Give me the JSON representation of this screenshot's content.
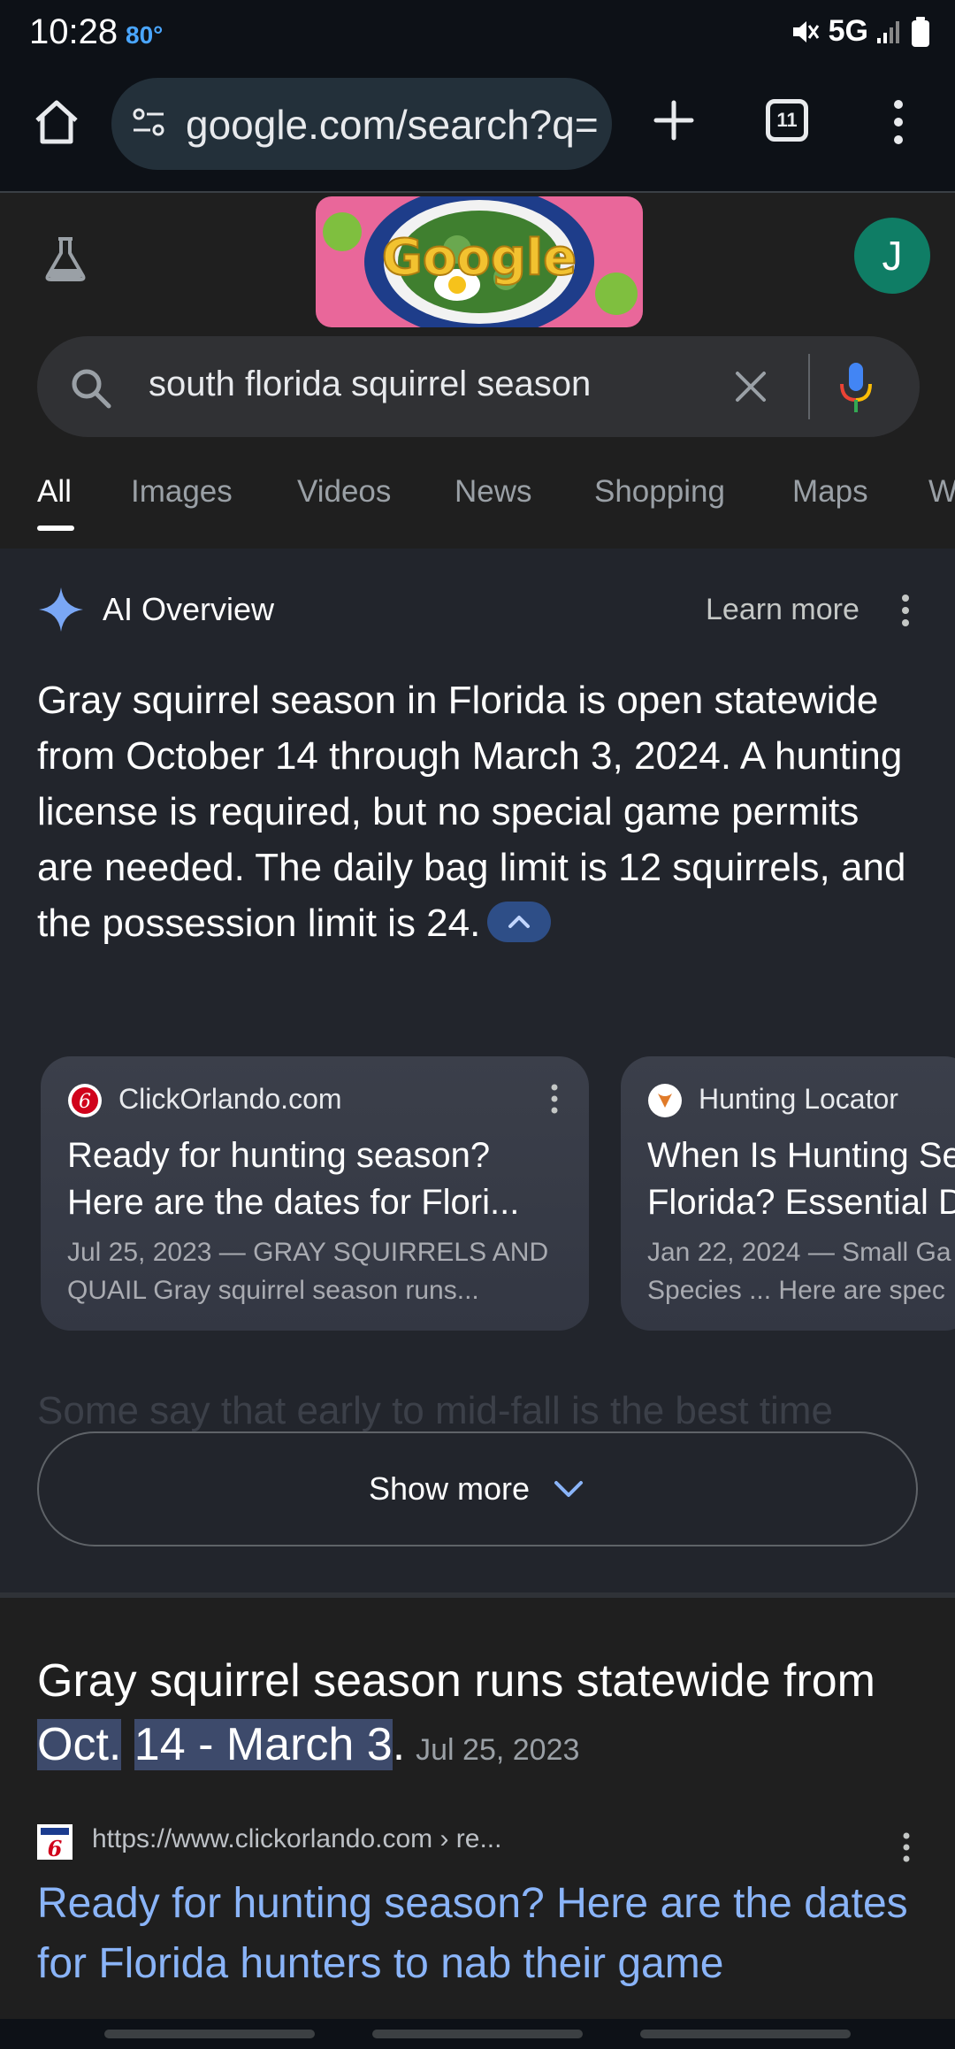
{
  "status_bar": {
    "time": "10:28",
    "temperature": "80°",
    "network": "5G"
  },
  "browser": {
    "url": "google.com/search?q=",
    "tab_count": "11"
  },
  "header": {
    "avatar_letter": "J",
    "doodle_text": "Google"
  },
  "search": {
    "query": "south florida squirrel season"
  },
  "tabs": [
    {
      "label": "All"
    },
    {
      "label": "Images"
    },
    {
      "label": "Videos"
    },
    {
      "label": "News"
    },
    {
      "label": "Shopping"
    },
    {
      "label": "Maps"
    },
    {
      "label": "W"
    }
  ],
  "ai_overview": {
    "title": "AI Overview",
    "learn_more": "Learn more",
    "body": "Gray squirrel season in Florida is open statewide from October 14 through March 3, 2024. A hunting license is required, but no special game permits are needed. The daily bag limit is 12 squirrels, and the possession limit is 24.",
    "faded_text": "Some say that early to mid-fall is the best time",
    "show_more": "Show more",
    "sources": [
      {
        "site": "ClickOrlando.com",
        "title": "Ready for hunting season? Here are the dates for Flori...",
        "snippet": "Jul 25, 2023 — GRAY SQUIRRELS AND QUAIL Gray squirrel season runs..."
      },
      {
        "site": "Hunting Locator",
        "title": "When Is Hunting Se Florida? Essential D",
        "snippet": "Jan 22, 2024 — Small Ga Species ... Here are spec"
      }
    ]
  },
  "featured": {
    "text_before": "Gray squirrel season runs statewide from ",
    "highlight_1": "Oct.",
    "highlight_2": "14 - March 3",
    "text_after": ".",
    "date": "Jul 25, 2023"
  },
  "result": {
    "url": "https://www.clickorlando.com › re...",
    "title": "Ready for hunting season? Here are the dates for Florida hunters to nab their game"
  },
  "colors": {
    "accent_blue": "#8ab4f8",
    "avatar_green": "#0f7d65",
    "background": "#1f1f1f"
  }
}
